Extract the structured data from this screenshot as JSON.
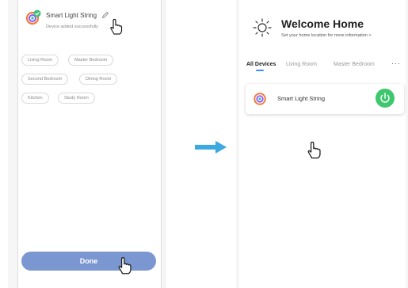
{
  "left_screen": {
    "device_name": "Smart Light String",
    "device_status": "Device added successfully",
    "rooms": [
      "Living Room",
      "Master Bedroom",
      "Second Bedroom",
      "Dining Room",
      "Kitchen",
      "Study Room"
    ],
    "done_label": "Done"
  },
  "right_screen": {
    "title": "Welcome Home",
    "subtitle": "Set your home location for more information  >",
    "tabs": [
      "All Devices",
      "Living Room",
      "Master Bedroom"
    ],
    "more_label": "···",
    "device_name": "Smart Light String"
  },
  "colors": {
    "done_button": "#7a97d2",
    "power_button": "#3fc76f",
    "arrow": "#3ea8e0",
    "tab_underline": "#3d8bff"
  },
  "icons": [
    "device-logo-icon",
    "check-badge-icon",
    "pencil-icon",
    "hand-pointer-icon",
    "arrow-right-icon",
    "sun-icon",
    "power-icon"
  ]
}
